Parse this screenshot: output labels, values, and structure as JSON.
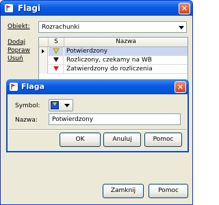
{
  "main": {
    "title": "Flagi",
    "object_label": "Obiekt:",
    "object_value": "Rozrachunki",
    "side_links": [
      "Dodaj",
      "Popraw",
      "Usuń"
    ],
    "grid": {
      "col_symbol": "S",
      "col_name": "Nazwa",
      "rows": [
        {
          "name": "Potwierdzony",
          "flag_color": "#e8d21a",
          "selected": true
        },
        {
          "name": "Rozliczony, czekamy na WB",
          "flag_color": "#1a1a1a",
          "selected": false
        },
        {
          "name": "Zatwierdzony do rozliczenia",
          "flag_color": "#d8231f",
          "selected": false
        }
      ]
    },
    "close_button": "Zamknij",
    "help_button": "Pomoc"
  },
  "dialog": {
    "title": "Flaga",
    "symbol_label": "Symbol:",
    "name_label": "Nazwa:",
    "name_value": "Potwierdzony",
    "ok_button": "OK",
    "cancel_button": "Anuluj",
    "help_button": "Pomoc"
  },
  "colors": {
    "titlebar": "#0a5be0",
    "window_bg": "#ece9d8",
    "selection": "#c8d6f2"
  }
}
